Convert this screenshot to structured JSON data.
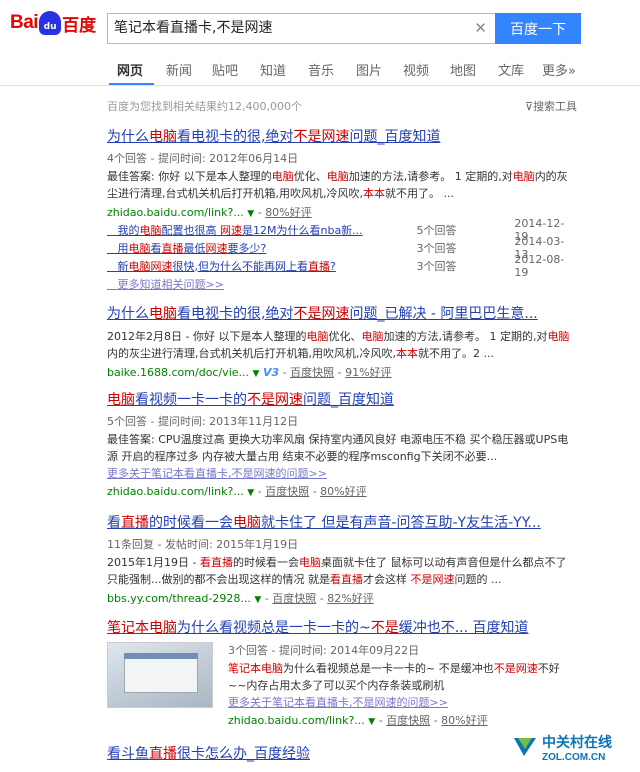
{
  "logo": {
    "text_left": "Bai",
    "text_paw": "du",
    "text_right": "百度"
  },
  "search": {
    "value": "笔记本看直播卡,不是网速",
    "button": "百度一下",
    "clear_icon": "close-icon"
  },
  "tabs": [
    "网页",
    "新闻",
    "贴吧",
    "知道",
    "音乐",
    "图片",
    "视频",
    "地图",
    "文库",
    "更多»"
  ],
  "active_tab": "网页",
  "stats": "百度为您找到相关结果约12,400,000个",
  "tools": "搜索工具",
  "results": [
    {
      "title_parts": [
        "为什么",
        "电脑",
        "看电视卡的很,绝对",
        "不是",
        "网速",
        "问题_百度知道"
      ],
      "meta": "4个回答 - 提问时间: 2012年06月14日",
      "snippet_parts": [
        "最佳答案: 你好 以下是本人整理的",
        "电脑",
        "优化、",
        "电脑",
        "加速的方法,请参考。 1 定期的,对",
        "电脑",
        "内的灰尘进行清理,台式机关机后打开机箱,用吹风机,冷风吹,",
        "本本",
        "就不用了。 ..."
      ],
      "url": "zhidao.baidu.com/link?...",
      "rating": "80%好评",
      "sub_items": [
        {
          "title_parts": [
            "我的",
            "电脑",
            "配置也很高 ",
            "网速",
            "是12M为什么看nba新..."
          ],
          "count": "5个回答",
          "date": "2014-12-19"
        },
        {
          "title_parts": [
            "用",
            "电脑",
            "看",
            "直播",
            "最低",
            "网速",
            "要多少?"
          ],
          "count": "3个回答",
          "date": "2014-03-13"
        },
        {
          "title_parts": [
            "新",
            "电脑",
            "网速",
            "很快,但为什么不能再网上看",
            "直播",
            "?"
          ],
          "count": "3个回答",
          "date": "2012-08-19"
        }
      ],
      "more": "更多知道相关问题>>"
    },
    {
      "title_parts": [
        "为什么",
        "电脑",
        "看电视卡的很,绝对",
        "不是",
        "网速",
        "问题_已解决 - 阿里巴巴生意..."
      ],
      "snippet_parts": [
        "2012年2月8日 - 你好 以下是本人整理的",
        "电脑",
        "优化、",
        "电脑",
        "加速的方法,请参考。 1 定期的,对",
        "电脑",
        "内的灰尘进行清理,台式机关机后打开机箱,用吹风机,冷风吹,",
        "本本",
        "就不用了。2 ..."
      ],
      "url": "baike.1688.com/doc/vie...",
      "badge": "V3",
      "snapshot": "百度快照",
      "rating": "91%好评"
    },
    {
      "title_parts": [
        "电脑",
        "看视频一卡一卡的",
        "不是",
        "网速",
        "问题_百度知道"
      ],
      "meta": "5个回答 - 提问时间: 2013年11月12日",
      "snippet_parts": [
        "最佳答案: CPU温度过高 更换大功率风扇 保持室内通风良好 电源电压不稳 买个稳压器或UPS电源 开启的程序过多 内存被大量占用 结束不必要的程序msconfig下关闭不必要..."
      ],
      "more": "更多关于笔记本看直播卡,不是网速的问题>>",
      "url": "zhidao.baidu.com/link?...",
      "snapshot": "百度快照",
      "rating": "80%好评"
    },
    {
      "title_parts": [
        "看",
        "直播",
        "的时候看一会",
        "电脑",
        "就卡住了 但是有声音-问答互助-Y友生活-YY..."
      ],
      "meta": "11条回复 - 发帖时间: 2015年1月19日",
      "snippet_parts": [
        "2015年1月19日 - ",
        "看直播",
        "的时候看一会",
        "电脑",
        "桌面就卡住了 鼠标可以动有声音但是什么都点不了 只能强制...做别的都不会出现这样的情况 就是",
        "看直播",
        "才会这样 ",
        "不是",
        "网速",
        "问题的 ..."
      ],
      "url": "bbs.yy.com/thread-2928...",
      "snapshot": "百度快照",
      "rating": "82%好评"
    },
    {
      "title_parts": [
        "笔记本电脑",
        "为什么看视频总是一卡一卡的~",
        "不是",
        "缓冲也不... 百度知道"
      ],
      "meta": "3个回答 - 提问时间: 2014年09月22日",
      "snippet_parts": [
        "笔记本电脑",
        "为什么看视频总是一卡一卡的~ 不是缓冲也",
        "不是网速",
        "不好~~内存占用太多了可以买个内存条装或刷机"
      ],
      "more": "更多关于笔记本看直播卡,不是网速的问题>>",
      "url": "zhidao.baidu.com/link?...",
      "snapshot": "百度快照",
      "rating": "80%好评"
    },
    {
      "title_parts": [
        "看斗鱼",
        "直播",
        "很卡怎么办_百度经验"
      ]
    }
  ],
  "watermark": {
    "cn": "中关村在线",
    "en": "ZOL.COM.CN"
  },
  "colors": {
    "link": "#2440b3",
    "highlight": "#c00",
    "url_green": "#008000",
    "search_button": "#3385ff",
    "tab_underline": "#38f"
  }
}
